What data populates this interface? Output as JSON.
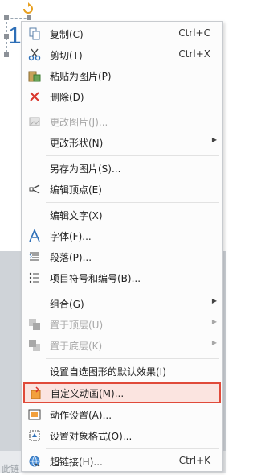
{
  "background": {
    "truncated_text": "此链"
  },
  "slide": {
    "shape_text": "1"
  },
  "menu": {
    "items": [
      {
        "label": "复制(C)",
        "shortcut": "Ctrl+C",
        "icon": "copy-icon",
        "disabled": false
      },
      {
        "label": "剪切(T)",
        "shortcut": "Ctrl+X",
        "icon": "cut-icon",
        "disabled": false
      },
      {
        "label": "粘贴为图片(P)",
        "shortcut": "",
        "icon": "paste-image-icon",
        "disabled": false
      },
      {
        "label": "删除(D)",
        "shortcut": "",
        "icon": "delete-icon",
        "disabled": false
      },
      {
        "label": "更改图片(J)...",
        "shortcut": "",
        "icon": "change-image-icon",
        "disabled": true
      },
      {
        "label": "更改形状(N)",
        "shortcut": "",
        "icon": "",
        "disabled": false,
        "submenu": true
      },
      {
        "label": "另存为图片(S)...",
        "shortcut": "",
        "icon": "",
        "disabled": false
      },
      {
        "label": "编辑顶点(E)",
        "shortcut": "",
        "icon": "edit-points-icon",
        "disabled": false
      },
      {
        "label": "编辑文字(X)",
        "shortcut": "",
        "icon": "",
        "disabled": false
      },
      {
        "label": "字体(F)...",
        "shortcut": "",
        "icon": "font-icon",
        "disabled": false
      },
      {
        "label": "段落(P)...",
        "shortcut": "",
        "icon": "paragraph-icon",
        "disabled": false
      },
      {
        "label": "项目符号和编号(B)...",
        "shortcut": "",
        "icon": "bullets-icon",
        "disabled": false
      },
      {
        "label": "组合(G)",
        "shortcut": "",
        "icon": "",
        "disabled": false,
        "submenu": true
      },
      {
        "label": "置于顶层(U)",
        "shortcut": "",
        "icon": "bring-front-icon",
        "disabled": true,
        "submenu": true
      },
      {
        "label": "置于底层(K)",
        "shortcut": "",
        "icon": "send-back-icon",
        "disabled": true,
        "submenu": true
      },
      {
        "label": "设置自选图形的默认效果(I)",
        "shortcut": "",
        "icon": "",
        "disabled": false
      },
      {
        "label": "自定义动画(M)...",
        "shortcut": "",
        "icon": "custom-animation-icon",
        "disabled": false,
        "highlighted": true
      },
      {
        "label": "动作设置(A)...",
        "shortcut": "",
        "icon": "action-settings-icon",
        "disabled": false
      },
      {
        "label": "设置对象格式(O)...",
        "shortcut": "",
        "icon": "format-object-icon",
        "disabled": false
      },
      {
        "label": "超链接(H)...",
        "shortcut": "Ctrl+K",
        "icon": "hyperlink-icon",
        "disabled": false
      }
    ]
  },
  "colors": {
    "highlight_border": "#e04a3a",
    "highlight_fill": "#fbe4e0",
    "accent_blue": "#2e6fb7"
  }
}
